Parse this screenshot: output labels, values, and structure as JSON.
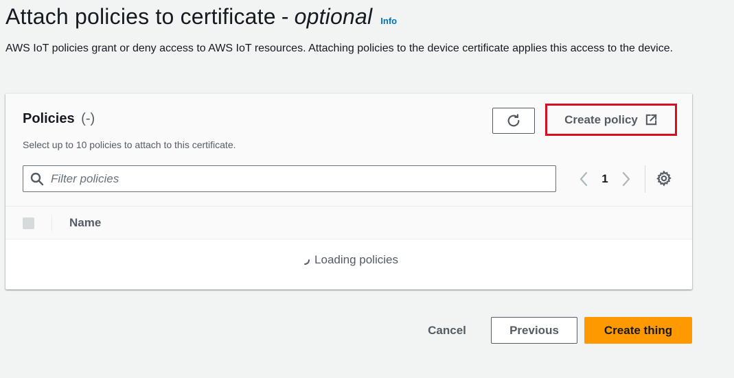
{
  "header": {
    "title_main": "Attach policies to certificate",
    "title_separator": "-",
    "title_optional": "optional",
    "info_link": "Info",
    "description": "AWS IoT policies grant or deny access to AWS IoT resources. Attaching policies to the device certificate applies this access to the device."
  },
  "policies_panel": {
    "title": "Policies",
    "count": "(-)",
    "subtitle": "Select up to 10 policies to attach to this certificate.",
    "refresh_icon": "refresh-icon",
    "create_policy_label": "Create policy",
    "create_policy_icon": "external-link-icon",
    "filter_placeholder": "Filter policies",
    "filter_value": "",
    "search_icon": "search-icon",
    "pagination": {
      "current_page": "1"
    },
    "settings_icon": "gear-icon",
    "table": {
      "columns": [
        "Name"
      ],
      "loading_text": "Loading policies"
    }
  },
  "footer": {
    "cancel_label": "Cancel",
    "previous_label": "Previous",
    "create_thing_label": "Create thing"
  },
  "colors": {
    "primary_button": "#ff9900",
    "highlight_border": "#d90d20",
    "link": "#0073bb"
  }
}
